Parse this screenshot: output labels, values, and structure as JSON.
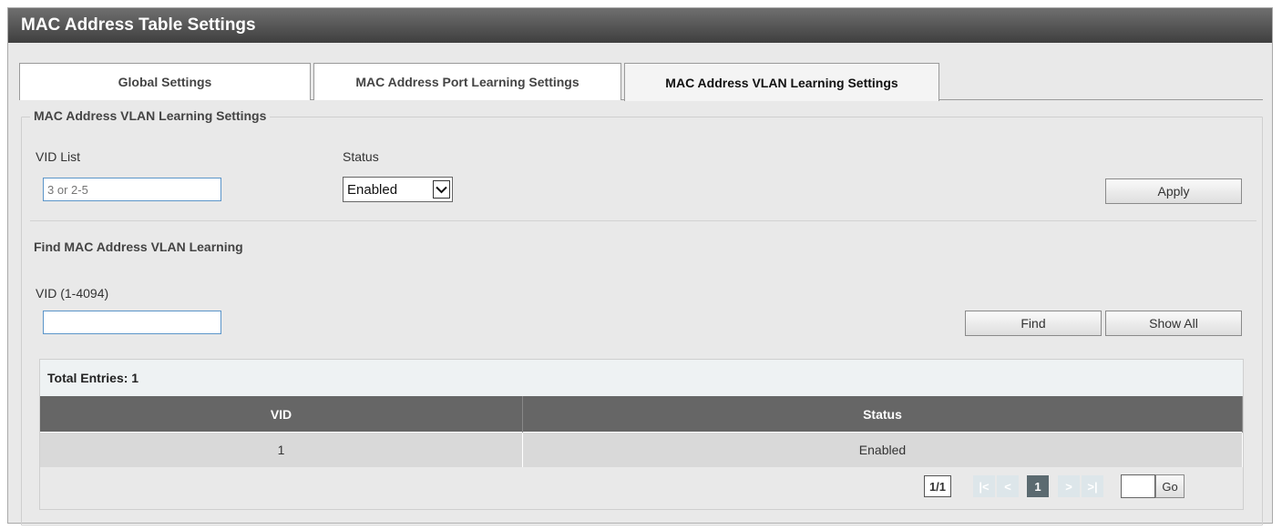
{
  "window": {
    "title": "MAC Address Table Settings"
  },
  "tabs": [
    {
      "label": "Global Settings",
      "active": false
    },
    {
      "label": "MAC Address Port Learning Settings",
      "active": false
    },
    {
      "label": "MAC Address VLAN Learning Settings",
      "active": true
    }
  ],
  "settings": {
    "legend": "MAC Address VLAN Learning Settings",
    "vid_list_label": "VID List",
    "vid_list_placeholder": "3 or 2-5",
    "vid_list_value": "",
    "status_label": "Status",
    "status_value": "Enabled",
    "apply_label": "Apply"
  },
  "find": {
    "title": "Find MAC Address VLAN Learning",
    "vid_label": "VID (1-4094)",
    "vid_value": "",
    "find_label": "Find",
    "show_all_label": "Show All"
  },
  "table": {
    "total_entries": "Total Entries: 1",
    "columns": [
      "VID",
      "Status"
    ],
    "rows": [
      {
        "vid": "1",
        "status": "Enabled"
      }
    ]
  },
  "pagination": {
    "page_indicator": "1/1",
    "first": "|<",
    "prev": "<",
    "current": "1",
    "next": ">",
    "last": ">|",
    "go_label": "Go",
    "go_value": ""
  },
  "colors": {
    "header_bg": "#666666",
    "titlebar_top": "#6f6f6f",
    "titlebar_bottom": "#3f3f3f",
    "input_border": "#5b95c9",
    "panel_bg": "#e9e9e9"
  }
}
